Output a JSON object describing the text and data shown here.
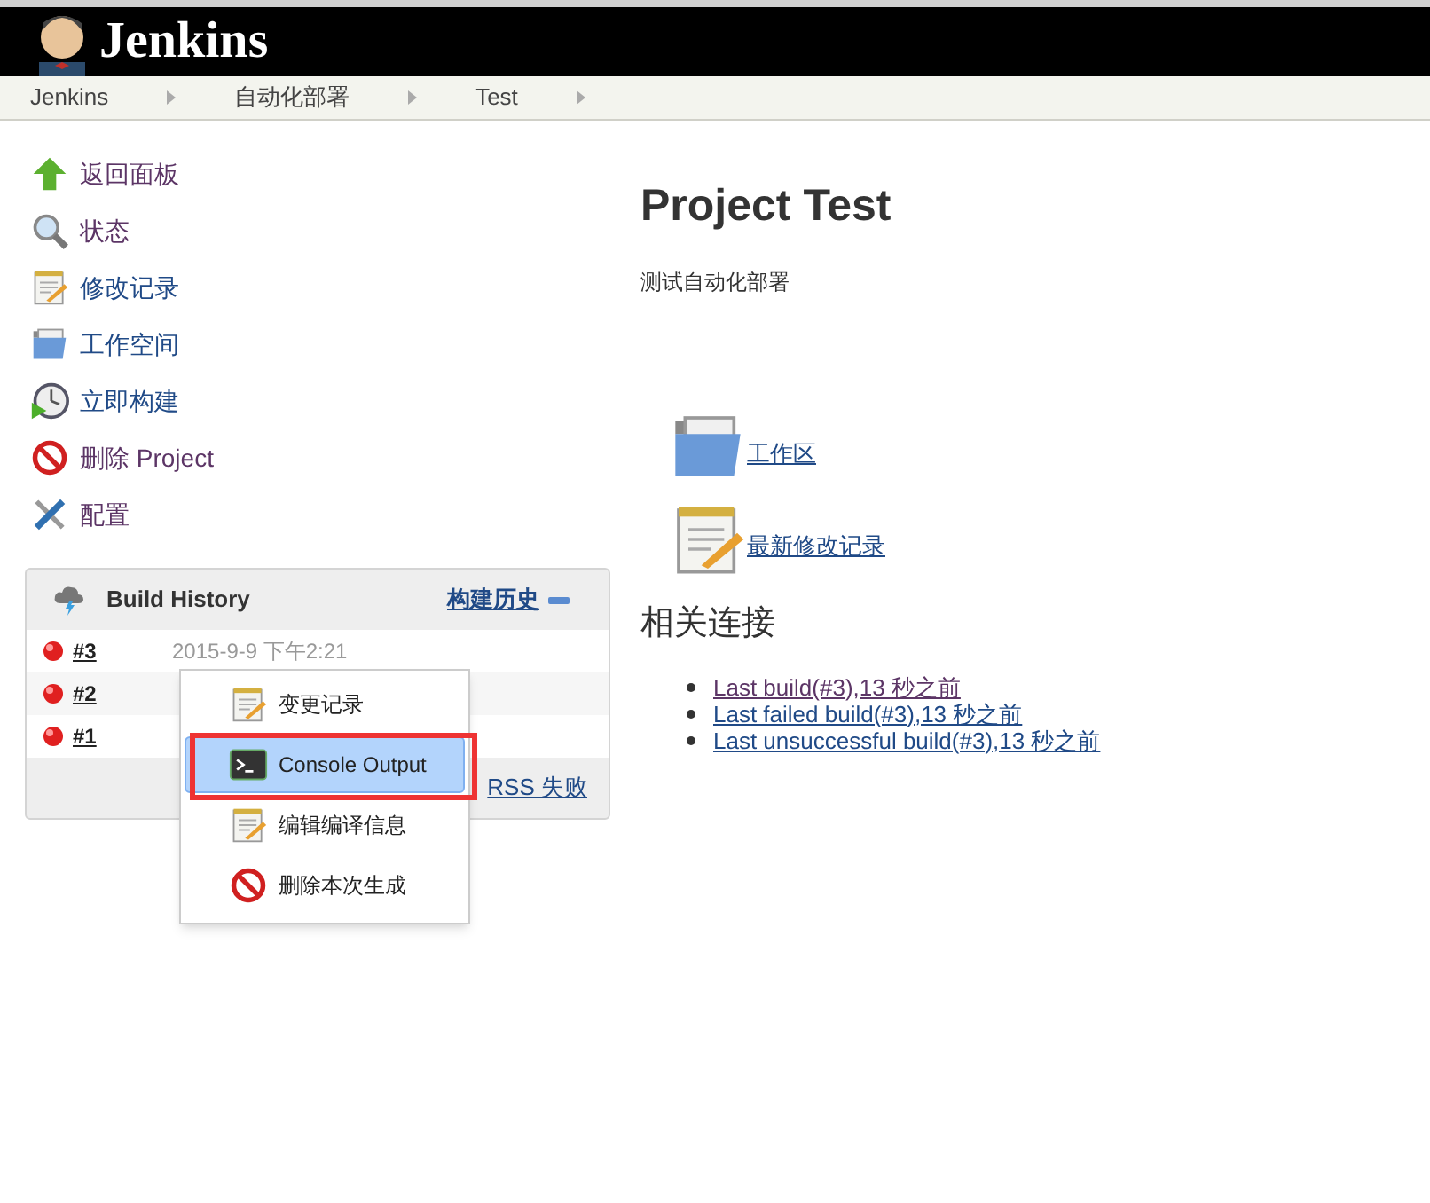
{
  "header": {
    "title": "Jenkins"
  },
  "breadcrumbs": [
    "Jenkins",
    "自动化部署",
    "Test"
  ],
  "sidebar": {
    "items": [
      {
        "kind": "up",
        "label": "返回面板",
        "visited": true
      },
      {
        "kind": "search",
        "label": "状态",
        "visited": true
      },
      {
        "kind": "notepad",
        "label": "修改记录",
        "visited": false
      },
      {
        "kind": "folder",
        "label": "工作空间",
        "visited": false
      },
      {
        "kind": "clock",
        "label": "立即构建",
        "visited": false
      },
      {
        "kind": "forbidden",
        "label": "删除 Project",
        "visited": true
      },
      {
        "kind": "tools",
        "label": "配置",
        "visited": true
      }
    ]
  },
  "build_history": {
    "title": "Build History",
    "trend_link": "构建历史",
    "builds": [
      {
        "number": "#3",
        "date": "2015-9-9 下午2:21"
      },
      {
        "number": "#2"
      },
      {
        "number": "#1"
      }
    ],
    "rss_link": "RSS 失败"
  },
  "context_menu": {
    "items": [
      {
        "kind": "notepad",
        "label": "变更记录",
        "selected": false
      },
      {
        "kind": "terminal",
        "label": "Console Output",
        "selected": true
      },
      {
        "kind": "notepad",
        "label": "编辑编译信息",
        "selected": false
      },
      {
        "kind": "forbidden",
        "label": "删除本次生成",
        "selected": false
      }
    ]
  },
  "main": {
    "title": "Project Test",
    "description": "测试自动化部署",
    "big_links": [
      {
        "kind": "folder",
        "label": "工作区"
      },
      {
        "kind": "notepad",
        "label": "最新修改记录"
      }
    ],
    "related_title": "相关连接",
    "related_links": [
      {
        "label": "Last build(#3),13 秒之前",
        "visited": true
      },
      {
        "label": "Last failed build(#3),13 秒之前",
        "visited": false
      },
      {
        "label": "Last unsuccessful build(#3),13 秒之前",
        "visited": false
      }
    ]
  }
}
